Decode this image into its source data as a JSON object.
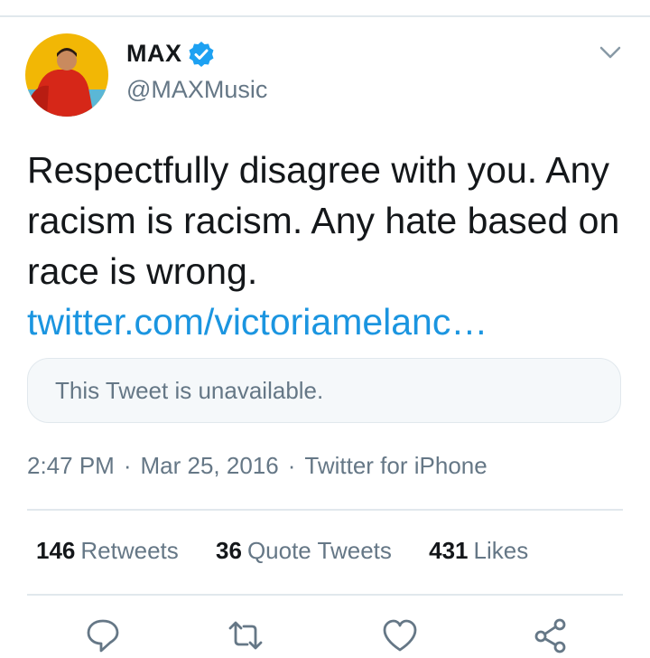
{
  "user": {
    "display_name": "MAX",
    "handle": "@MAXMusic",
    "verified": true
  },
  "tweet": {
    "text": "Respectfully disagree with you. Any racism is racism. Any hate based on race is wrong.",
    "link": "twitter.com/victoriamelanc…",
    "quoted_unavailable": "This Tweet is unavailable.",
    "time": "2:47 PM",
    "date": "Mar 25, 2016",
    "source": "Twitter for iPhone"
  },
  "stats": {
    "retweets_count": "146",
    "retweets_label": "Retweets",
    "quotes_count": "36",
    "quotes_label": "Quote Tweets",
    "likes_count": "431",
    "likes_label": "Likes"
  },
  "actions": [
    "reply-icon",
    "retweet-icon",
    "like-icon",
    "share-icon"
  ],
  "colors": {
    "link": "#1b95e0",
    "verified": "#1da1f2",
    "muted": "#657786",
    "border": "#e1e8ed"
  }
}
